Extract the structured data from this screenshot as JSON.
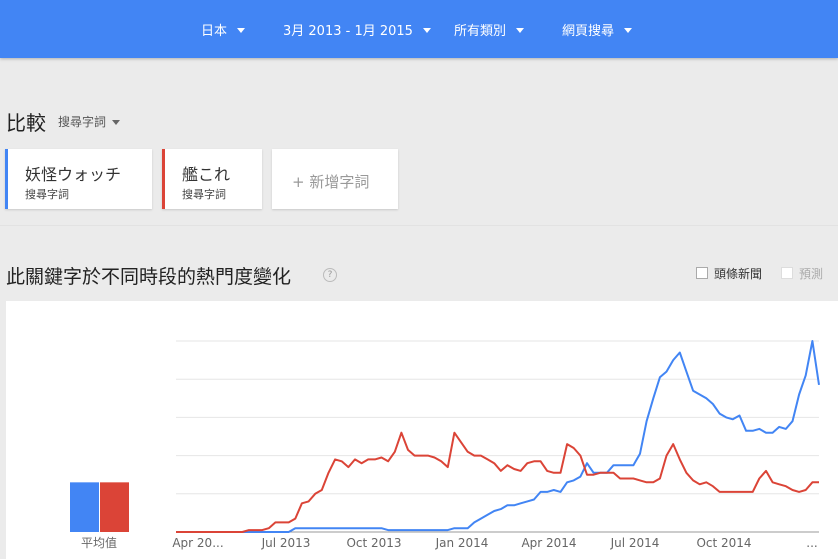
{
  "topbar": {
    "region": "日本",
    "date_range": "3月 2013 - 1月 2015",
    "category": "所有類別",
    "search_type": "網頁搜尋"
  },
  "compare": {
    "title": "比較",
    "term_type": "搜尋字詞"
  },
  "terms": [
    {
      "name": "妖怪ウォッチ",
      "sub": "搜尋字詞",
      "color": "#4285f4"
    },
    {
      "name": "艦これ",
      "sub": "搜尋字詞",
      "color": "#db4437"
    }
  ],
  "add_term": "+ 新增字詞",
  "section": {
    "title": "此關鍵字於不同時段的熱門度變化",
    "help_icon": "?",
    "headlines_label": "頭條新聞",
    "forecast_label": "預測"
  },
  "average_label": "平均值",
  "chart_data": {
    "type": "line",
    "ylim": [
      0,
      100
    ],
    "x_tick_labels": [
      "Apr 20...",
      "Jul 2013",
      "Oct 2013",
      "Jan 2014",
      "Apr 2014",
      "Jul 2014",
      "Oct 2014",
      "..."
    ],
    "averages": [
      {
        "series": "妖怪ウォッチ",
        "value": 26
      },
      {
        "series": "艦これ",
        "value": 26
      }
    ],
    "series": [
      {
        "name": "妖怪ウォッチ",
        "color": "#4285f4",
        "values": [
          0,
          0,
          0,
          0,
          0,
          0,
          0,
          0,
          0,
          0,
          0,
          0,
          0,
          0,
          0,
          0,
          0,
          0,
          2,
          2,
          2,
          2,
          2,
          2,
          2,
          2,
          2,
          2,
          2,
          2,
          2,
          2,
          1,
          1,
          1,
          1,
          1,
          1,
          1,
          1,
          1,
          1,
          2,
          2,
          2,
          5,
          7,
          9,
          11,
          12,
          14,
          14,
          15,
          16,
          17,
          21,
          21,
          22,
          21,
          26,
          27,
          29,
          36,
          31,
          31,
          31,
          35,
          35,
          35,
          35,
          41,
          58,
          70,
          81,
          84,
          90,
          94,
          84,
          74,
          72,
          70,
          67,
          62,
          60,
          59,
          61,
          53,
          53,
          54,
          52,
          52,
          55,
          54,
          58,
          72,
          82,
          100,
          77
        ],
        "x_start": "2013-03-03",
        "x_step_days": 7
      },
      {
        "name": "艦これ",
        "color": "#db4437",
        "values": [
          0,
          0,
          0,
          0,
          0,
          0,
          0,
          0,
          0,
          0,
          0,
          1,
          1,
          1,
          2,
          5,
          5,
          5,
          7,
          15,
          16,
          20,
          22,
          31,
          38,
          37,
          34,
          38,
          36,
          38,
          38,
          39,
          37,
          42,
          52,
          43,
          40,
          40,
          40,
          39,
          37,
          34,
          52,
          47,
          42,
          40,
          40,
          38,
          36,
          32,
          35,
          33,
          32,
          36,
          37,
          37,
          32,
          31,
          31,
          46,
          44,
          40,
          30,
          30,
          31,
          31,
          31,
          28,
          28,
          28,
          27,
          26,
          26,
          28,
          40,
          46,
          38,
          31,
          27,
          25,
          26,
          24,
          21,
          21,
          21,
          21,
          21,
          21,
          28,
          32,
          26,
          25,
          24,
          22,
          21,
          22,
          26,
          26
        ],
        "x_start": "2013-03-03",
        "x_step_days": 7
      }
    ]
  }
}
